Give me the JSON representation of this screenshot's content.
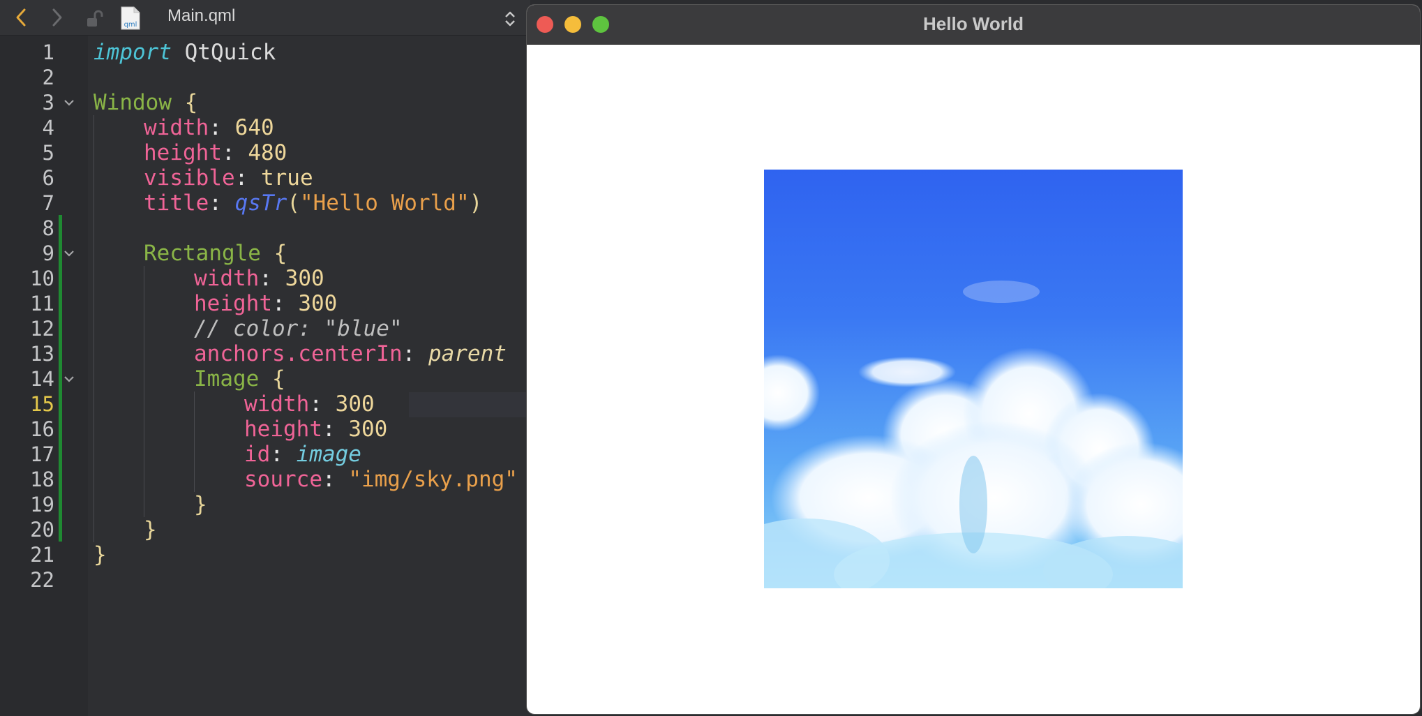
{
  "toolbar": {
    "back_icon": "chevron-left-icon",
    "forward_icon": "chevron-right-icon",
    "lock_icon": "unlocked-icon",
    "file_icon": "qml-file-icon",
    "file_icon_label": "qml",
    "file_name": "Main.qml"
  },
  "editor": {
    "line_numbers": [
      "1",
      "2",
      "3",
      "4",
      "5",
      "6",
      "7",
      "8",
      "9",
      "10",
      "11",
      "12",
      "13",
      "14",
      "15",
      "16",
      "17",
      "18",
      "19",
      "20",
      "21",
      "22"
    ],
    "current_line": "15",
    "code": {
      "l1": {
        "kw": "import",
        "rest": " QtQuick"
      },
      "l3": {
        "type": "Window",
        "brace": " {"
      },
      "l4": {
        "prop": "width",
        "colon": ": ",
        "val": "640"
      },
      "l5": {
        "prop": "height",
        "colon": ": ",
        "val": "480"
      },
      "l6": {
        "prop": "visible",
        "colon": ": ",
        "val": "true"
      },
      "l7": {
        "prop": "title",
        "colon": ": ",
        "fn": "qsTr",
        "open": "(",
        "str": "\"Hello World\"",
        "close": ")"
      },
      "l9": {
        "type": "Rectangle",
        "brace": " {"
      },
      "l10": {
        "prop": "width",
        "colon": ": ",
        "val": "300"
      },
      "l11": {
        "prop": "height",
        "colon": ": ",
        "val": "300"
      },
      "l12": {
        "comment": "// color: \"blue\""
      },
      "l13": {
        "prop": "anchors.centerIn",
        "colon": ": ",
        "val": "parent"
      },
      "l14": {
        "type": "Image",
        "brace": " {"
      },
      "l15": {
        "prop": "width",
        "colon": ": ",
        "val": "300"
      },
      "l16": {
        "prop": "height",
        "colon": ": ",
        "val": "300"
      },
      "l17": {
        "prop": "id",
        "colon": ": ",
        "val": "image"
      },
      "l18": {
        "prop": "source",
        "colon": ": ",
        "str": "\"img/sky.png\""
      },
      "l19": {
        "brace": "}"
      },
      "l20": {
        "brace": "}"
      },
      "l21": {
        "brace": "}"
      }
    }
  },
  "preview": {
    "title": "Hello World",
    "close_color": "#ee5b55",
    "minimize_color": "#f5bd3b",
    "maximize_color": "#5ec43f",
    "image_description_icon": "sky-image"
  },
  "colors": {
    "editor_bg": "#2e2f32",
    "keyword": "#4dc4d6",
    "type": "#8ab547",
    "property": "#f06497",
    "string": "#e9a04b",
    "number": "#eed79b",
    "function": "#5878f2",
    "current_line_number": "#e5c94b",
    "change_marker": "#1f8a32"
  }
}
